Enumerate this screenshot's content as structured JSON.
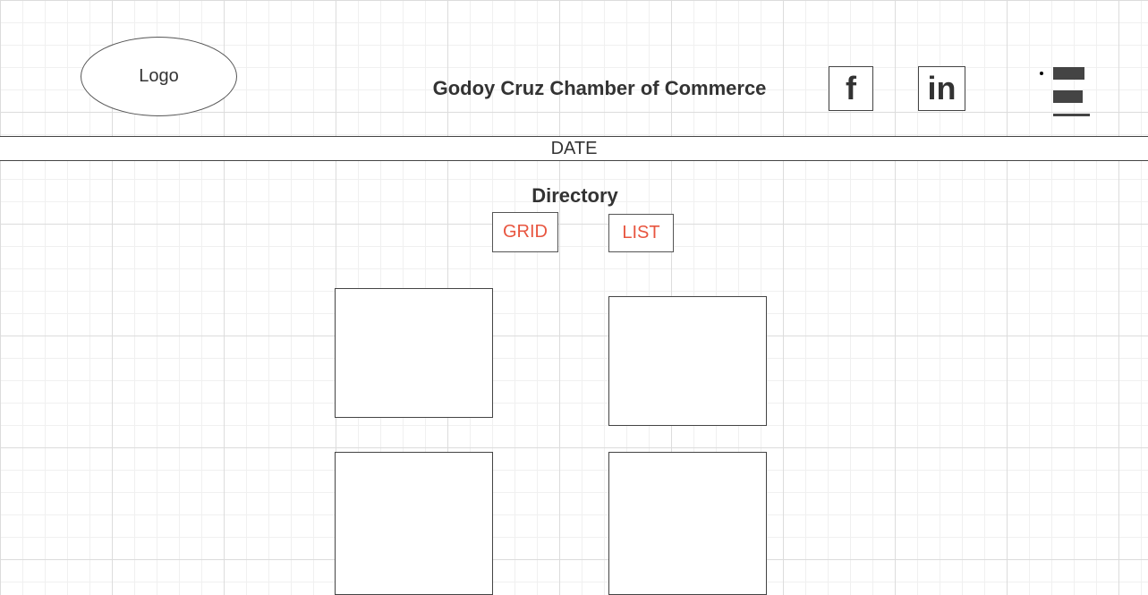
{
  "header": {
    "logo_text": "Logo",
    "site_title": "Godoy Cruz Chamber of Commerce",
    "social": {
      "facebook_glyph": "f",
      "linkedin_glyph": "in"
    },
    "menu_icon": "hamburger-icon"
  },
  "date_bar": {
    "text": "DATE"
  },
  "directory": {
    "heading": "Directory",
    "view_buttons": {
      "grid_label": "GRID",
      "list_label": "LIST"
    },
    "cards": [
      "",
      "",
      "",
      ""
    ]
  },
  "colors": {
    "accent": "#e8553f",
    "text": "#333333",
    "border": "#444444"
  }
}
